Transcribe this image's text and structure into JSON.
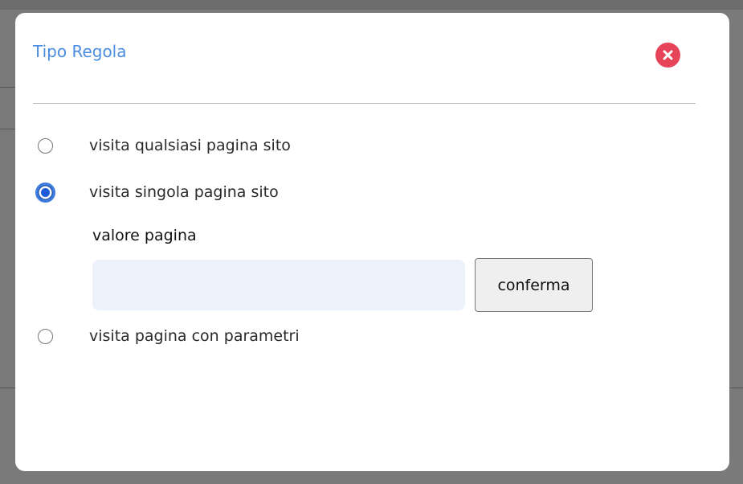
{
  "modal": {
    "title": "Tipo Regola",
    "close_icon": "close-x-icon",
    "options": [
      {
        "label": "visita qualsiasi pagina sito",
        "checked": false
      },
      {
        "label": "visita singola pagina sito",
        "checked": true
      },
      {
        "label": "visita pagina con parametri",
        "checked": false
      }
    ],
    "page_value": {
      "label": "valore pagina",
      "value": "",
      "placeholder": ""
    },
    "confirm_label": "conferma"
  },
  "colors": {
    "title": "#4a8de0",
    "close_button": "#e54459",
    "radio_checked": "#1d5bd8",
    "input_background": "#ebf2fc"
  }
}
